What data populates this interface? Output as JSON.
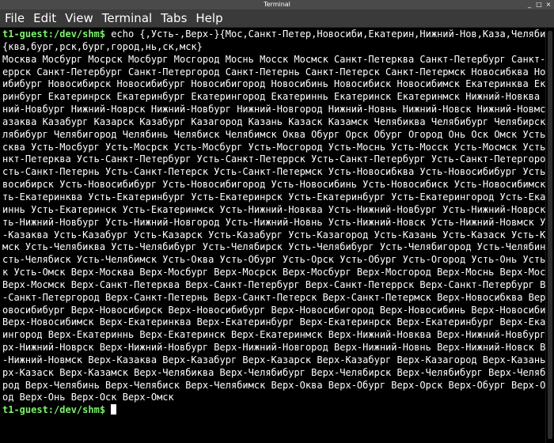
{
  "window": {
    "title": "Terminal",
    "buttons": {
      "minimize": "_",
      "maximize": "□",
      "close": "×"
    }
  },
  "menu": [
    "File",
    "Edit",
    "View",
    "Terminal",
    "Tabs",
    "Help"
  ],
  "terminal": {
    "prompt": "t1-guest:/dev/shm$",
    "command": " echo {,Усть-,Верх-}{Мос,Санкт-Петер,Новосиби,Екатерин,Нижний-Нов,Каза,Челяби,О}{ква,бург,рск,бург,город,нь,ск,мск}",
    "output": "Москва Мосбург Мосрск Мосбург Мосгород Моснь Мосск Мосмск Санкт-Петерква Санкт-Петербург Санкт-Петеррск Санкт-Петербург Санкт-Петергород Санкт-Петернь Санкт-Петерск Санкт-Петермск Новосибква Новосибибург Новосибирск Новосибибург Новосибигород Новосибинь Новосибиск Новосибимск Екатеринква Екатеринбург Екатеринрск Екатеринбург Екатерингород Екатериннь Екатеринск Екатеринмск Нижний-Новква Нижний-Новбург Нижний-Новрск Нижний-Новбург Нижний-Новгород Нижний-Новнь Нижний-Новск Нижний-Новмск Казаква Казабург Казарск Казабург Казагород Казань Казаск Казамск Челябиква Челябибург Челябирск Челябибург Челябигород Челябинь Челябиск Челябимск Оква Обург Орск Обург Огород Онь Оск Омск Усть-Москва Усть-Мосбург Усть-Мосрск Усть-Мосбург Усть-Мосгород Усть-Моснь Усть-Мосск Усть-Мосмск Усть-Санкт-Петерква Усть-Санкт-Петербург Усть-Санкт-Петеррск Усть-Санкт-Петербург Усть-Санкт-Петергород Усть-Санкт-Петернь Усть-Санкт-Петерск Усть-Санкт-Петермск Усть-Новосибква Усть-Новосибибург Усть-Новосибирск Усть-Новосибибург Усть-Новосибигород Усть-Новосибинь Усть-Новосибиск Усть-Новосибимск Усть-Екатеринква Усть-Екатеринбург Усть-Екатеринрск Усть-Екатеринбург Усть-Екатерингород Усть-Екатериннь Усть-Екатеринск Усть-Екатеринмск Усть-Нижний-Новква Усть-Нижний-Новбург Усть-Нижний-Новрск Усть-Нижний-Новбург Усть-Нижний-Новгород Усть-Нижний-Новнь Усть-Нижний-Новск Усть-Нижний-Новмск Усть-Казаква Усть-Казабург Усть-Казарск Усть-Казабург Усть-Казагород Усть-Казань Усть-Казаск Усть-Казамск Усть-Челябиква Усть-Челябибург Усть-Челябирск Усть-Челябибург Усть-Челябигород Усть-Челябинь Усть-Челябиск Усть-Челябимск Усть-Оква Усть-Обург Усть-Орск Усть-Обург Усть-Огород Усть-Онь Усть-Оск Усть-Омск Верх-Москва Верх-Мосбург Верх-Мосрск Верх-Мосбург Верх-Мосгород Верх-Моснь Верх-Мосск Верх-Мосмск Верх-Санкт-Петерква Верх-Санкт-Петербург Верх-Санкт-Петеррск Верх-Санкт-Петербург Верх-Санкт-Петергород Верх-Санкт-Петернь Верх-Санкт-Петерск Верх-Санкт-Петермск Верх-Новосибква Верх-Новосибибург Верх-Новосибирск Верх-Новосибибург Верх-Новосибигород Верх-Новосибинь Верх-Новосибиск Верх-Новосибимск Верх-Екатеринква Верх-Екатеринбург Верх-Екатеринрск Верх-Екатеринбург Верх-Екатерингород Верх-Екатериннь Верх-Екатеринск Верх-Екатеринмск Верх-Нижний-Новква Верх-Нижний-Новбург Верх-Нижний-Новрск Верх-Нижний-Новбург Верх-Нижний-Новгород Верх-Нижний-Новнь Верх-Нижний-Новск Верх-Нижний-Новмск Верх-Казаква Верх-Казабург Верх-Казарск Верх-Казабург Верх-Казагород Верх-Казань Верх-Казаск Верх-Казамск Верх-Челябиква Верх-Челябибург Верх-Челябирск Верх-Челябибург Верх-Челябигород Верх-Челябинь Верх-Челябиск Верх-Челябимск Верх-Оква Верх-Обург Верх-Орск Верх-Обург Верх-Огород Верх-Онь Верх-Оск Верх-Омск"
  }
}
